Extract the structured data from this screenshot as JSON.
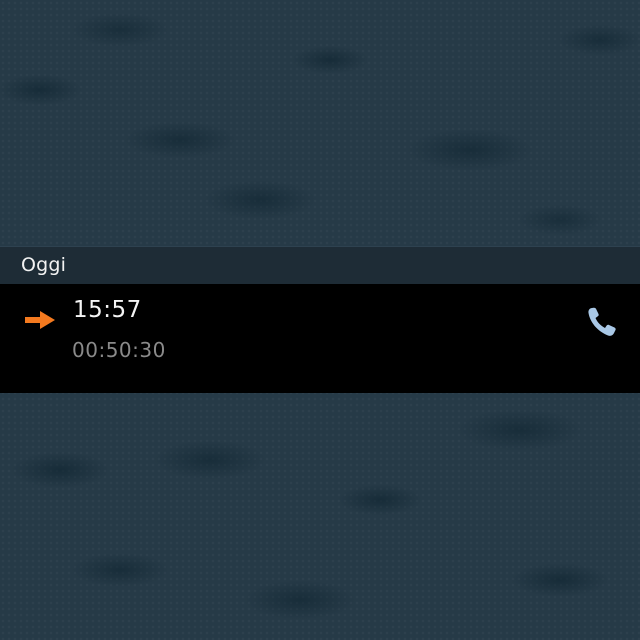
{
  "call_log": {
    "section_header": "Oggi",
    "entries": [
      {
        "time": "15:57",
        "duration": "00:50:30",
        "direction_icon": "outgoing-arrow-icon",
        "action_icon": "phone-handset-icon"
      }
    ]
  },
  "colors": {
    "background": "#263a47",
    "header_background": "#1e2c36",
    "row_background": "#000000",
    "arrow": "#f47a1f",
    "phone_icon": "#a9c8e6",
    "time_text": "#f4f4f4",
    "duration_text": "#8a8a8a"
  }
}
